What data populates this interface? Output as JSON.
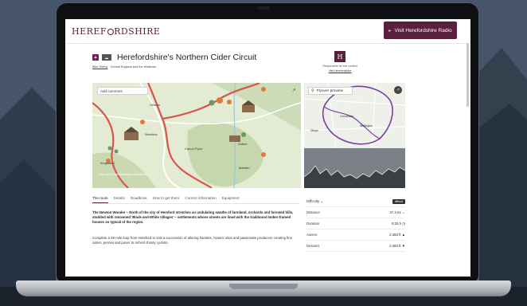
{
  "header": {
    "logo_text_pre": "HEREF",
    "logo_text_post": "RDSHIRE",
    "radio_button_label": "Visit Herefordshire Radio"
  },
  "route": {
    "category_badge": "",
    "type_badge": "",
    "title": "Herefordshire's Northern Cider Circuit",
    "subtitle_link": "Bike Riding",
    "subtitle_rest": " · Central England and the Midlands"
  },
  "author": {
    "logo_letter": "H",
    "responsible_text": "Responsible for this content",
    "link_text": "Visit Herefordshire"
  },
  "map": {
    "add_comment_label": "Add comment",
    "places": [
      "Orleton",
      "Weobley",
      "Canon Pyon",
      "Sutton",
      "Marden",
      "Kingsland",
      "Dilwyn",
      "Eardisland",
      "Moreton on Lugg"
    ],
    "credit": "Map data © OpenStreetMap contributors"
  },
  "flyover": {
    "label": "Flyover preview",
    "places": [
      "Leominster",
      "Dilwyn",
      "Wellington",
      "Hereford"
    ]
  },
  "tabs": [
    "The route",
    "Details",
    "Roadbook",
    "How to get there",
    "Current information",
    "Equipment"
  ],
  "description": {
    "lead": "The Newton Wonder – North of the city of Hereford stretches an undulating swathe of farmland, orchards and forested hills, studded with renowned 'Black-and-White Villages' – settlements whose streets are lined with the traditional timber-framed houses so typical of the region.",
    "body": "Complete a 49-mile loop from Hereford to visit a succession of alluring hamlets, historic sites and passionate producers creating fine ciders, perries and juices to refresh thirsty cyclists."
  },
  "stats": {
    "difficulty_label": "Difficulty",
    "difficulty_value": "difficult",
    "rows": [
      {
        "label": "Distance",
        "value": "47.4 mi"
      },
      {
        "label": "Duration",
        "value": "5:25 h"
      },
      {
        "label": "Ascent",
        "value": "2,483 ft"
      },
      {
        "label": "Descent",
        "value": "2,483 ft"
      }
    ]
  },
  "colors": {
    "brand": "#5b1f3e",
    "route": "#d9534f",
    "flyover_route": "#7b3fa0"
  }
}
